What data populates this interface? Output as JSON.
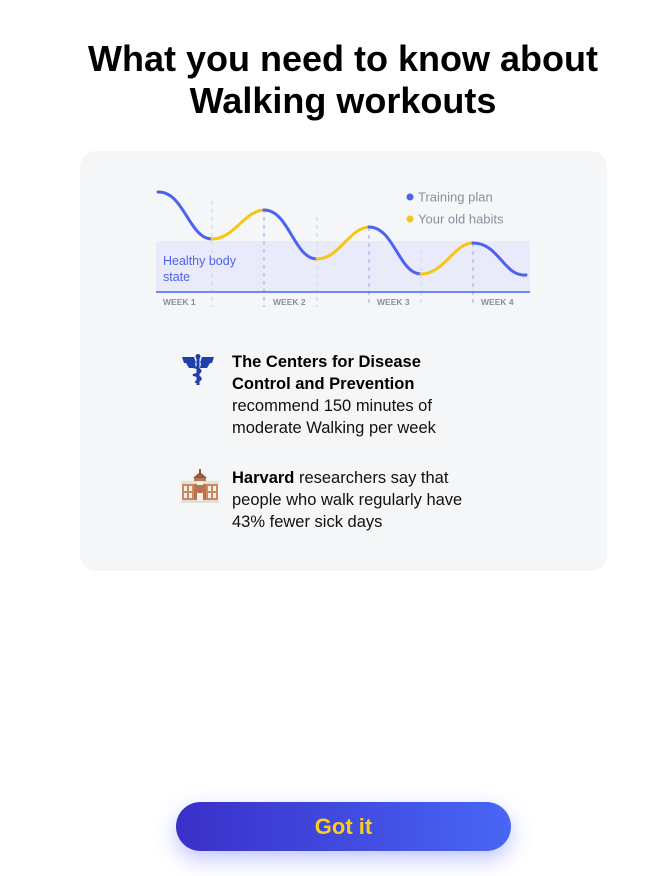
{
  "header": {
    "title_line1": "What you need to know about",
    "title_line2": "Walking workouts"
  },
  "chart_data": {
    "type": "line",
    "legend": [
      "Training plan",
      "Your old habits"
    ],
    "legend_placement": "top-right",
    "band_label": "Healthy body state",
    "x_tick_labels": [
      "WEEK 1",
      "WEEK 2",
      "WEEK 3",
      "WEEK 4"
    ],
    "colors": {
      "training": "#4c63ee",
      "habits": "#f5c518",
      "band": "#e9ebfa",
      "axis": "#4c63ee"
    }
  },
  "facts": [
    {
      "icon": "caduceus-icon",
      "bold": "The Centers for Disease Control and Prevention",
      "rest": " recommend 150 minutes of moderate Walking per week"
    },
    {
      "icon": "university-building-icon",
      "bold": "Harvard",
      "rest": " researchers say that people who walk regularly have 43% fewer sick days"
    }
  ],
  "actions": {
    "primary_label": "Got it"
  }
}
